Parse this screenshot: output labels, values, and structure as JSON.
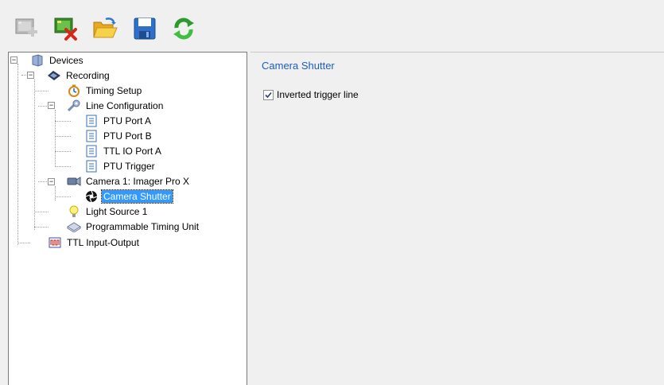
{
  "toolbar": {
    "buttons": [
      {
        "name": "add-device",
        "icon": "add-device-icon"
      },
      {
        "name": "remove-device",
        "icon": "remove-device-icon"
      },
      {
        "name": "open",
        "icon": "open-folder-icon"
      },
      {
        "name": "save",
        "icon": "save-icon"
      },
      {
        "name": "refresh",
        "icon": "refresh-icon"
      }
    ]
  },
  "tree": {
    "devices": "Devices",
    "recording": "Recording",
    "timing_setup": "Timing Setup",
    "line_configuration": "Line Configuration",
    "ptu_port_a": "PTU Port A",
    "ptu_port_b": "PTU Port B",
    "ttl_io_port_a": "TTL IO Port A",
    "ptu_trigger": "PTU Trigger",
    "camera_1": "Camera 1: Imager Pro X",
    "camera_shutter": "Camera Shutter",
    "light_source_1": "Light Source 1",
    "ptu": "Programmable Timing Unit",
    "ttl_input_output": "TTL Input-Output"
  },
  "content": {
    "title": "Camera Shutter",
    "inverted_trigger_line": {
      "label": "Inverted trigger line",
      "checked": true
    }
  },
  "colors": {
    "selection": "#3399ff",
    "title": "#1c5eb8"
  }
}
